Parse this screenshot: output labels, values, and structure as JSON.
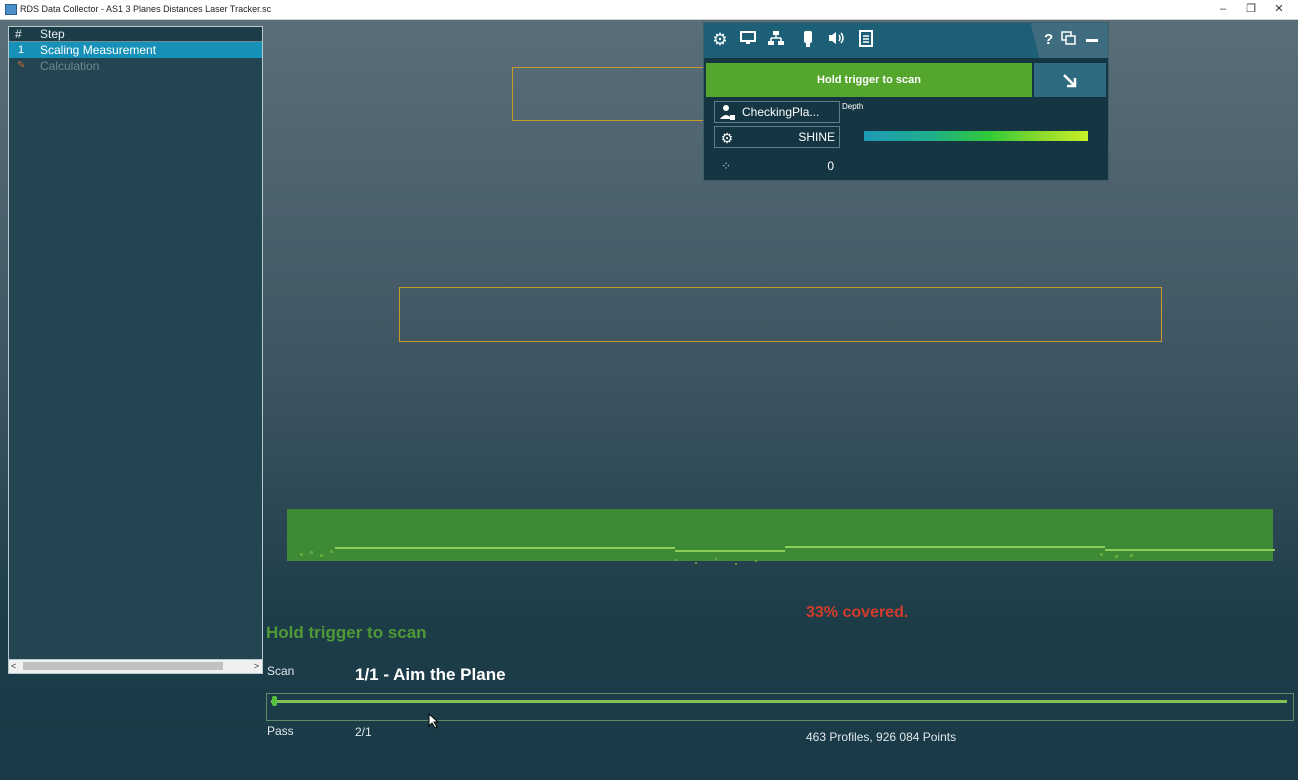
{
  "window": {
    "title": "RDS Data Collector - AS1 3 Planes Distances Laser Tracker.sc",
    "minimize": "–",
    "maximize": "❐",
    "close": "✕"
  },
  "steps": {
    "header_hash": "#",
    "header_label": "Step",
    "items": [
      {
        "num": "1",
        "label": "Scaling Measurement",
        "active": true
      },
      {
        "num": "",
        "label": "Calculation",
        "active": false
      }
    ],
    "scroll_left": "<",
    "scroll_right": ">"
  },
  "status": {
    "coverage": "33% covered.",
    "hold_message": "Hold trigger to scan",
    "scan_label": "Scan",
    "scan_title": "1/1 - Aim the Plane",
    "pass_label": "Pass",
    "pass_value": "2/1",
    "points_info": "463 Profiles, 926 084 Points",
    "scan_progress": 0.0
  },
  "scan_panel": {
    "toolbar_icons": [
      "gear-icon",
      "monitor-icon",
      "network-icon",
      "scanner-icon",
      "sound-icon",
      "log-icon"
    ],
    "help": "?",
    "restore_icon": "restore-icon",
    "minimize_icon": "minimize-icon",
    "trigger_button": "Hold trigger to scan",
    "expand_icon": "expand-arrow-icon",
    "depth_label": "Depth",
    "profile_value": "CheckingPla...",
    "surface_value": "SHINE",
    "point_count": "0"
  },
  "colors": {
    "accent": "#1791b7",
    "scan_green": "#54a62d",
    "coverage_red": "#d43b2a",
    "frame_gold": "#c99a2a"
  }
}
